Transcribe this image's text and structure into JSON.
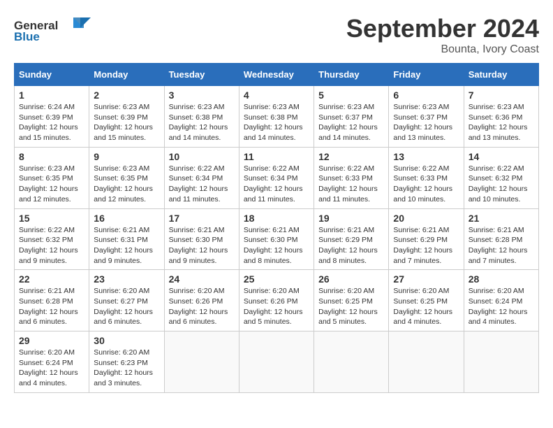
{
  "header": {
    "logo_general": "General",
    "logo_blue": "Blue",
    "month_year": "September 2024",
    "location": "Bounta, Ivory Coast"
  },
  "weekdays": [
    "Sunday",
    "Monday",
    "Tuesday",
    "Wednesday",
    "Thursday",
    "Friday",
    "Saturday"
  ],
  "weeks": [
    [
      {
        "day": "1",
        "sunrise": "6:24 AM",
        "sunset": "6:39 PM",
        "daylight": "12 hours and 15 minutes."
      },
      {
        "day": "2",
        "sunrise": "6:23 AM",
        "sunset": "6:39 PM",
        "daylight": "12 hours and 15 minutes."
      },
      {
        "day": "3",
        "sunrise": "6:23 AM",
        "sunset": "6:38 PM",
        "daylight": "12 hours and 14 minutes."
      },
      {
        "day": "4",
        "sunrise": "6:23 AM",
        "sunset": "6:38 PM",
        "daylight": "12 hours and 14 minutes."
      },
      {
        "day": "5",
        "sunrise": "6:23 AM",
        "sunset": "6:37 PM",
        "daylight": "12 hours and 14 minutes."
      },
      {
        "day": "6",
        "sunrise": "6:23 AM",
        "sunset": "6:37 PM",
        "daylight": "12 hours and 13 minutes."
      },
      {
        "day": "7",
        "sunrise": "6:23 AM",
        "sunset": "6:36 PM",
        "daylight": "12 hours and 13 minutes."
      }
    ],
    [
      {
        "day": "8",
        "sunrise": "6:23 AM",
        "sunset": "6:35 PM",
        "daylight": "12 hours and 12 minutes."
      },
      {
        "day": "9",
        "sunrise": "6:23 AM",
        "sunset": "6:35 PM",
        "daylight": "12 hours and 12 minutes."
      },
      {
        "day": "10",
        "sunrise": "6:22 AM",
        "sunset": "6:34 PM",
        "daylight": "12 hours and 11 minutes."
      },
      {
        "day": "11",
        "sunrise": "6:22 AM",
        "sunset": "6:34 PM",
        "daylight": "12 hours and 11 minutes."
      },
      {
        "day": "12",
        "sunrise": "6:22 AM",
        "sunset": "6:33 PM",
        "daylight": "12 hours and 11 minutes."
      },
      {
        "day": "13",
        "sunrise": "6:22 AM",
        "sunset": "6:33 PM",
        "daylight": "12 hours and 10 minutes."
      },
      {
        "day": "14",
        "sunrise": "6:22 AM",
        "sunset": "6:32 PM",
        "daylight": "12 hours and 10 minutes."
      }
    ],
    [
      {
        "day": "15",
        "sunrise": "6:22 AM",
        "sunset": "6:32 PM",
        "daylight": "12 hours and 9 minutes."
      },
      {
        "day": "16",
        "sunrise": "6:21 AM",
        "sunset": "6:31 PM",
        "daylight": "12 hours and 9 minutes."
      },
      {
        "day": "17",
        "sunrise": "6:21 AM",
        "sunset": "6:30 PM",
        "daylight": "12 hours and 9 minutes."
      },
      {
        "day": "18",
        "sunrise": "6:21 AM",
        "sunset": "6:30 PM",
        "daylight": "12 hours and 8 minutes."
      },
      {
        "day": "19",
        "sunrise": "6:21 AM",
        "sunset": "6:29 PM",
        "daylight": "12 hours and 8 minutes."
      },
      {
        "day": "20",
        "sunrise": "6:21 AM",
        "sunset": "6:29 PM",
        "daylight": "12 hours and 7 minutes."
      },
      {
        "day": "21",
        "sunrise": "6:21 AM",
        "sunset": "6:28 PM",
        "daylight": "12 hours and 7 minutes."
      }
    ],
    [
      {
        "day": "22",
        "sunrise": "6:21 AM",
        "sunset": "6:28 PM",
        "daylight": "12 hours and 6 minutes."
      },
      {
        "day": "23",
        "sunrise": "6:20 AM",
        "sunset": "6:27 PM",
        "daylight": "12 hours and 6 minutes."
      },
      {
        "day": "24",
        "sunrise": "6:20 AM",
        "sunset": "6:26 PM",
        "daylight": "12 hours and 6 minutes."
      },
      {
        "day": "25",
        "sunrise": "6:20 AM",
        "sunset": "6:26 PM",
        "daylight": "12 hours and 5 minutes."
      },
      {
        "day": "26",
        "sunrise": "6:20 AM",
        "sunset": "6:25 PM",
        "daylight": "12 hours and 5 minutes."
      },
      {
        "day": "27",
        "sunrise": "6:20 AM",
        "sunset": "6:25 PM",
        "daylight": "12 hours and 4 minutes."
      },
      {
        "day": "28",
        "sunrise": "6:20 AM",
        "sunset": "6:24 PM",
        "daylight": "12 hours and 4 minutes."
      }
    ],
    [
      {
        "day": "29",
        "sunrise": "6:20 AM",
        "sunset": "6:24 PM",
        "daylight": "12 hours and 4 minutes."
      },
      {
        "day": "30",
        "sunrise": "6:20 AM",
        "sunset": "6:23 PM",
        "daylight": "12 hours and 3 minutes."
      },
      null,
      null,
      null,
      null,
      null
    ]
  ],
  "labels": {
    "sunrise": "Sunrise:",
    "sunset": "Sunset:",
    "daylight": "Daylight:"
  }
}
